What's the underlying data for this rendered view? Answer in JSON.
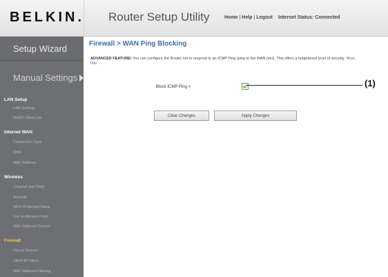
{
  "header": {
    "logo": "BELKIN.",
    "title": "Router Setup Utility",
    "links": [
      "Home",
      "Help",
      "Logout"
    ],
    "status": "Internet Status: Connected"
  },
  "sidebar": {
    "setup_wizard": "Setup Wizard",
    "manual_settings": "Manual Settings",
    "sections": [
      {
        "label": "LAN Setup",
        "items": [
          "LAN Settings",
          "DHCP Client List"
        ]
      },
      {
        "label": "Internet WAN",
        "items": [
          "Connection Type",
          "DNS",
          "MAC Address"
        ]
      },
      {
        "label": "Wireless",
        "items": [
          "Channel and SSID",
          "Security",
          "Wi-Fi Protected Setup",
          "Use as Access Point",
          "MAC Address Control"
        ]
      },
      {
        "label": "Firewall",
        "items": [
          "Virtual Servers",
          "Client IP Filters",
          "MAC Address Filtering"
        ]
      }
    ]
  },
  "main": {
    "title": "Firewall > WAN Ping Blocking",
    "description_prefix": "ADVANCED FEATURE!",
    "description": " You can configure the Router not to respond to an ICMP Ping (ping to the WAN port). This offers a heightened level of security.",
    "more_info": "More Info",
    "ping_label": "Block ICMP Ping >",
    "ping_checked": true,
    "clear_button": "Clear Changes",
    "apply_button": "Apply Changes"
  },
  "callout": {
    "label": "(1)"
  },
  "colors": {
    "sidebar_bg": "#6e6f74",
    "active_section": "#e7d12a",
    "title_blue": "#3f6ea5"
  }
}
